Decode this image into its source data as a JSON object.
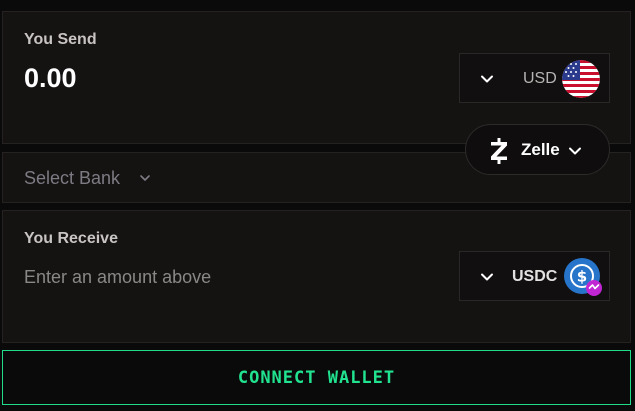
{
  "send": {
    "label": "You Send",
    "amount": "0.00",
    "currency": "USD",
    "currency_icon": "us-flag-icon"
  },
  "payment": {
    "method": "Zelle",
    "icon": "zelle-icon"
  },
  "bank": {
    "placeholder": "Select Bank"
  },
  "receive": {
    "label": "You Receive",
    "placeholder": "Enter an amount above",
    "currency": "USDC",
    "currency_icon": "usdc-icon"
  },
  "action": {
    "connect_label": "CONNECT WALLET"
  },
  "colors": {
    "accent": "#20e28f",
    "panel": "#151212",
    "usdc_blue": "#2775ca"
  }
}
